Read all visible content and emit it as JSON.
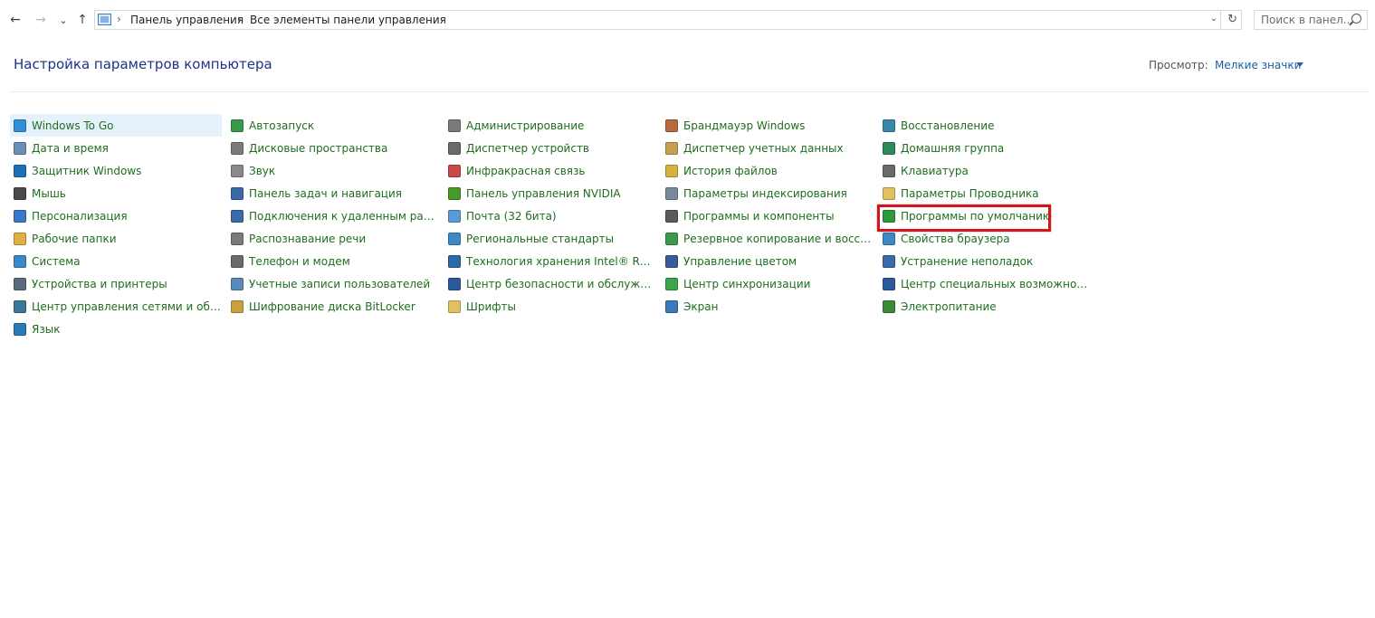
{
  "nav": {
    "back_glyph": "←",
    "forward_glyph": "→",
    "recent_glyph": "⌄",
    "up_glyph": "↑"
  },
  "address": {
    "crumbs": [
      "Панель управления",
      "Все элементы панели управления"
    ],
    "separator": "›",
    "dropdown_glyph": "⌄",
    "refresh_glyph": "↻"
  },
  "search": {
    "placeholder": "Поиск в панел..."
  },
  "header": {
    "title": "Настройка параметров компьютера",
    "view_label": "Просмотр:",
    "view_value": "Мелкие значки"
  },
  "columns": [
    [
      {
        "label": "Windows To Go",
        "icon": "windows-to-go-icon",
        "color": "#2f8fd8"
      },
      {
        "label": "Дата и время",
        "icon": "clock-icon",
        "color": "#6a8fb8"
      },
      {
        "label": "Защитник Windows",
        "icon": "shield-icon",
        "color": "#1f6fb8"
      },
      {
        "label": "Мышь",
        "icon": "mouse-icon",
        "color": "#4a4a4a"
      },
      {
        "label": "Персонализация",
        "icon": "personalization-icon",
        "color": "#3a78c8"
      },
      {
        "label": "Рабочие папки",
        "icon": "work-folders-icon",
        "color": "#e0b040"
      },
      {
        "label": "Система",
        "icon": "system-icon",
        "color": "#3a88c8"
      },
      {
        "label": "Устройства и принтеры",
        "icon": "printer-icon",
        "color": "#5a6a7a"
      },
      {
        "label": "Центр управления сетями и общи...",
        "icon": "network-icon",
        "color": "#3a7898"
      },
      {
        "label": "Язык",
        "icon": "language-icon",
        "color": "#2a7ab8"
      }
    ],
    [
      {
        "label": "Автозапуск",
        "icon": "autoplay-icon",
        "color": "#3a9a4a"
      },
      {
        "label": "Дисковые пространства",
        "icon": "storage-spaces-icon",
        "color": "#7a7a7a"
      },
      {
        "label": "Звук",
        "icon": "sound-icon",
        "color": "#8a8a8a"
      },
      {
        "label": "Панель задач и навигация",
        "icon": "taskbar-icon",
        "color": "#3a6aa8"
      },
      {
        "label": "Подключения к удаленным рабоч...",
        "icon": "remote-desktop-icon",
        "color": "#3a6aa8"
      },
      {
        "label": "Распознавание речи",
        "icon": "microphone-icon",
        "color": "#7a7a7a"
      },
      {
        "label": "Телефон и модем",
        "icon": "phone-modem-icon",
        "color": "#6a6a6a"
      },
      {
        "label": "Учетные записи пользователей",
        "icon": "user-accounts-icon",
        "color": "#5a8ab8"
      },
      {
        "label": "Шифрование диска BitLocker",
        "icon": "bitlocker-icon",
        "color": "#c8a040"
      }
    ],
    [
      {
        "label": "Администрирование",
        "icon": "admin-tools-icon",
        "color": "#7a7a7a"
      },
      {
        "label": "Диспетчер устройств",
        "icon": "device-manager-icon",
        "color": "#6a6a6a"
      },
      {
        "label": "Инфракрасная связь",
        "icon": "infrared-icon",
        "color": "#c84a4a"
      },
      {
        "label": "Панель управления NVIDIA",
        "icon": "nvidia-icon",
        "color": "#4a9a2a"
      },
      {
        "label": "Почта (32 бита)",
        "icon": "mail-icon",
        "color": "#5a9ad8"
      },
      {
        "label": "Региональные стандарты",
        "icon": "region-icon",
        "color": "#3a8ac8"
      },
      {
        "label": "Технология хранения Intel® Rapid",
        "icon": "intel-storage-icon",
        "color": "#2a6aa8"
      },
      {
        "label": "Центр безопасности и обслуживан...",
        "icon": "flag-icon",
        "color": "#2a5a9a"
      },
      {
        "label": "Шрифты",
        "icon": "fonts-icon",
        "color": "#e0c060"
      }
    ],
    [
      {
        "label": "Брандмауэр Windows",
        "icon": "firewall-icon",
        "color": "#b8683a"
      },
      {
        "label": "Диспетчер учетных данных",
        "icon": "credential-manager-icon",
        "color": "#c8a050"
      },
      {
        "label": "История файлов",
        "icon": "file-history-icon",
        "color": "#d8b040"
      },
      {
        "label": "Параметры индексирования",
        "icon": "indexing-icon",
        "color": "#7a8a9a"
      },
      {
        "label": "Программы и компоненты",
        "icon": "programs-icon",
        "color": "#5a5a5a"
      },
      {
        "label": "Резервное копирование и восстан...",
        "icon": "backup-icon",
        "color": "#3a9a4a"
      },
      {
        "label": "Управление цветом",
        "icon": "color-management-icon",
        "color": "#3a5a9a"
      },
      {
        "label": "Центр синхронизации",
        "icon": "sync-center-icon",
        "color": "#3aa84a"
      },
      {
        "label": "Экран",
        "icon": "display-icon",
        "color": "#3a7ab8"
      }
    ],
    [
      {
        "label": "Восстановление",
        "icon": "recovery-icon",
        "color": "#3a88a8"
      },
      {
        "label": "Домашняя группа",
        "icon": "homegroup-icon",
        "color": "#2a8a5a"
      },
      {
        "label": "Клавиатура",
        "icon": "keyboard-icon",
        "color": "#6a6a6a"
      },
      {
        "label": "Параметры Проводника",
        "icon": "explorer-options-icon",
        "color": "#e0c060"
      },
      {
        "label": "Программы по умолчанию",
        "icon": "default-programs-icon",
        "color": "#2a9a3a"
      },
      {
        "label": "Свойства браузера",
        "icon": "browser-properties-icon",
        "color": "#3a8ac8"
      },
      {
        "label": "Устранение неполадок",
        "icon": "troubleshooting-icon",
        "color": "#3a6aa8"
      },
      {
        "label": "Центр специальных возможностей",
        "icon": "ease-of-access-icon",
        "color": "#2a5a9a"
      },
      {
        "label": "Электропитание",
        "icon": "power-options-icon",
        "color": "#3a8a3a"
      }
    ]
  ],
  "colors": {
    "link_text": "#1e6e1e",
    "title_text": "#1e3287",
    "view_link": "#1a5fa8",
    "selection_bg": "#e5f1fb",
    "highlight_border": "#d4141b"
  }
}
